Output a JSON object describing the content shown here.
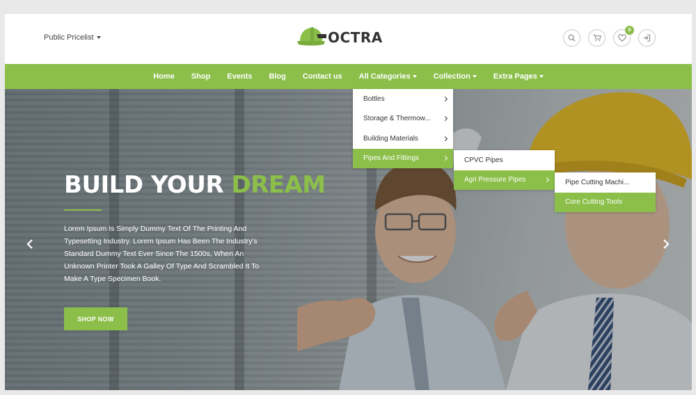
{
  "header": {
    "pricelist_label": "Public Pricelist",
    "logo_text": "OCTRA",
    "cart_count": "0"
  },
  "nav": {
    "items": [
      "Home",
      "Shop",
      "Events",
      "Blog",
      "Contact us",
      "All Categories",
      "Collection",
      "Extra Pages"
    ]
  },
  "menus": {
    "categories": [
      "Bottles",
      "Storage & Thermow...",
      "Building Materials",
      "Pipes And Fittings"
    ],
    "pipes": [
      "CPVC Pipes",
      "Agri Pressure Pipes"
    ],
    "agri": [
      "Pipe Cutting Machi...",
      "Core Cutting Tools"
    ]
  },
  "hero": {
    "title_main": "BUILD YOUR",
    "title_accent": "DREAM",
    "text": "Lorem Ipsum Is Simply Dummy Text Of The Printing And Typesetting Industry. Lorem Ipsum Has Been The Industry's Standard Dummy Text Ever Since The 1500s, When An Unknown Printer Took A Galley Of Type And Scrambled It To Make A Type Specimen Book.",
    "button_label": "SHOP NOW"
  },
  "colors": {
    "accent": "#8bbf4a",
    "text_dark": "#333333"
  },
  "icons": [
    "search-icon",
    "cart-icon",
    "heart-icon",
    "sign-in-icon",
    "chevron-left-icon",
    "chevron-right-icon",
    "helmet-logo-icon"
  ]
}
